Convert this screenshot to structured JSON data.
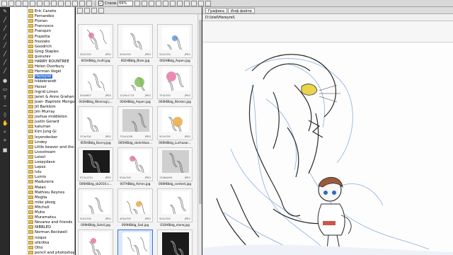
{
  "toolbar": {
    "check_label": "Стили",
    "zoom": "69%",
    "tab_graphics": "Графика",
    "tab_file_info": "Инф.файла"
  },
  "viewer": {
    "path": "D:\\Iziel\\Hereyrel\\"
  },
  "tree": {
    "items": [
      "Eric Canete",
      "Fernandes",
      "Florian",
      "Francesco",
      "Franquin",
      "Frazetta",
      "frezzato",
      "Goodrich",
      "Greg Staples",
      "gueuzav",
      "HARRY ROUNTREE",
      "Helen Overbury",
      "Herman Vogel",
      "Hereyrel",
      "hildebrandt",
      "Hoisel",
      "Ingrid Limen",
      "Janet & Anne Grahan",
      "Jean- Baptiste Mongu",
      "Jill Barklem",
      "Jim Murray",
      "joshua middleton",
      "Justin Gerard",
      "katurran",
      "Kim Jung Gi",
      "leyendecker",
      "Lindey",
      "Little beaver and the l",
      "Livestream",
      "Loisel",
      "Loopydave",
      "Lopez",
      "lulu",
      "Lumio",
      "Madureira",
      "Malan",
      "Mathieu Reynes",
      "Meglia",
      "mike ploog",
      "Mitchell",
      "Muhe",
      "Muramatsu",
      "Nevarez and friends",
      "NIBBLED",
      "Norman Rockwell",
      "noque",
      "otkritka",
      "Otto",
      "pencil and photoshop"
    ],
    "selected_index": 13
  },
  "thumbnails": [
    {
      "caption": "001HBblg_multi.jpg",
      "dims": "502x700",
      "fmt": "JPEG",
      "style": "sketch-color"
    },
    {
      "caption": "002HBblg_Bizer.jpg",
      "dims": "500x700",
      "fmt": "JPEG",
      "style": "sketch"
    },
    {
      "caption": "002HBblg_Aspen.jpg",
      "dims": "502x700",
      "fmt": "JPEG",
      "style": "sketch-color"
    },
    {
      "caption": "003HBblg_Wieningi.j...",
      "dims": "500x657",
      "fmt": "JPEG",
      "style": "sketch"
    },
    {
      "caption": "004HBblg_Aspen.jpg",
      "dims": "1229x1713",
      "fmt": "JPEG",
      "style": "color"
    },
    {
      "caption": "004HBblg_Sticken.jpg",
      "dims": "753x700",
      "fmt": "JPEG",
      "style": "color"
    },
    {
      "caption": "005HBblg_Bunny.jpg",
      "dims": "374x700",
      "fmt": "JPEG",
      "style": "sketch"
    },
    {
      "caption": "005HBblg_sketchbox...",
      "dims": "732x1038",
      "fmt": "JPEG",
      "style": "grey"
    },
    {
      "caption": "006HBblg_Luchaaar...",
      "dims": "502x700",
      "fmt": "JPEG",
      "style": "color"
    },
    {
      "caption": "006HBblg_sb2010.c...",
      "dims": "973x1231",
      "fmt": "JPEG",
      "style": "dark"
    },
    {
      "caption": "007HBblg_Aches.jpg",
      "dims": "500x700",
      "fmt": "JPEG",
      "style": "sketch-color"
    },
    {
      "caption": "008HBblg_contest.jpg",
      "dims": "1346x858",
      "fmt": "JPEG",
      "style": "grey"
    },
    {
      "caption": "009HBblg_Soleil.jpg",
      "dims": "502x700",
      "fmt": "JPEG",
      "style": "sketch"
    },
    {
      "caption": "009HBblg_Sad.jpg",
      "dims": "400x700",
      "fmt": "JPEG",
      "style": "sketch-color"
    },
    {
      "caption": "010HBblg_starw.jpg",
      "dims": "502x700",
      "fmt": "JPEG",
      "style": "sketch"
    },
    {
      "caption": "",
      "dims": "",
      "fmt": "",
      "style": "comic"
    },
    {
      "caption": "",
      "dims": "",
      "fmt": "",
      "style": "sketch"
    },
    {
      "caption": "",
      "dims": "",
      "fmt": "",
      "style": "dark"
    }
  ],
  "selected_thumbnail": 16
}
